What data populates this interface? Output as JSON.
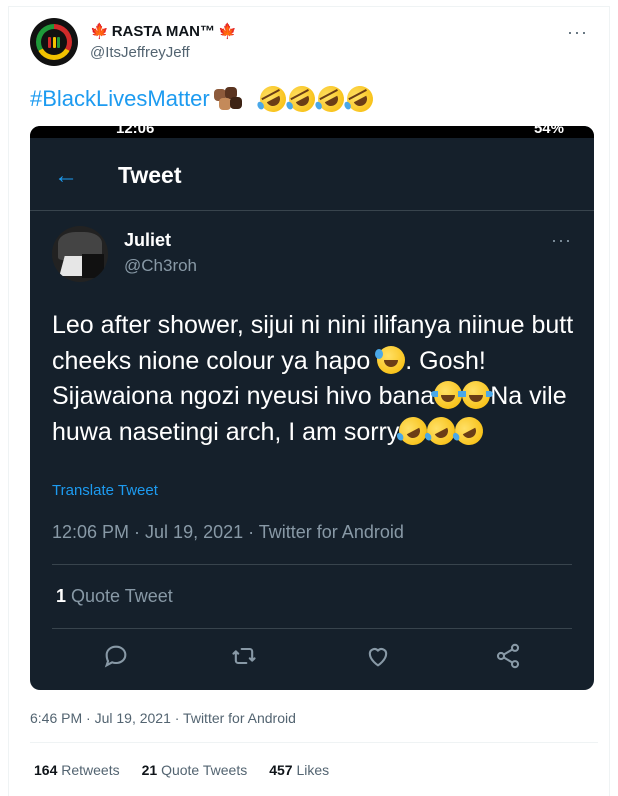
{
  "author": {
    "display_name": "RASTA MAN™",
    "handle": "@ItsJeffreyJeff"
  },
  "post": {
    "hashtag": "#BlackLivesMatter",
    "timestamp": "6:46 PM · Jul 19, 2021 · Twitter for Android",
    "stats": {
      "retweets_count": "164",
      "retweets_label": "Retweets",
      "quotes_count": "21",
      "quotes_label": "Quote Tweets",
      "likes_count": "457",
      "likes_label": "Likes"
    }
  },
  "screenshot": {
    "status_time": "12:06",
    "status_right": "54%",
    "header_title": "Tweet",
    "tweet": {
      "name": "Juliet",
      "handle": "@Ch3roh",
      "text_1": "Leo after shower, sijui ni nini ilifanya niinue butt cheeks nione colour ya hapo ",
      "text_2": ". Gosh! Sijawaiona ngozi nyeusi hivo bana",
      "text_3": "Na vile huwa nasetingi arch, I am sorry",
      "translate_label": "Translate Tweet",
      "meta": "12:06 PM · Jul 19, 2021 · Twitter for Android",
      "quote_count": "1",
      "quote_label": "Quote Tweet"
    }
  },
  "icons": [
    "more-icon",
    "back-arrow-icon",
    "reply-icon",
    "retweet-icon",
    "like-icon",
    "share-icon"
  ],
  "colors": {
    "accent": "#1d9bf0",
    "dark_bg": "#15202b",
    "muted": "#8899a6"
  }
}
